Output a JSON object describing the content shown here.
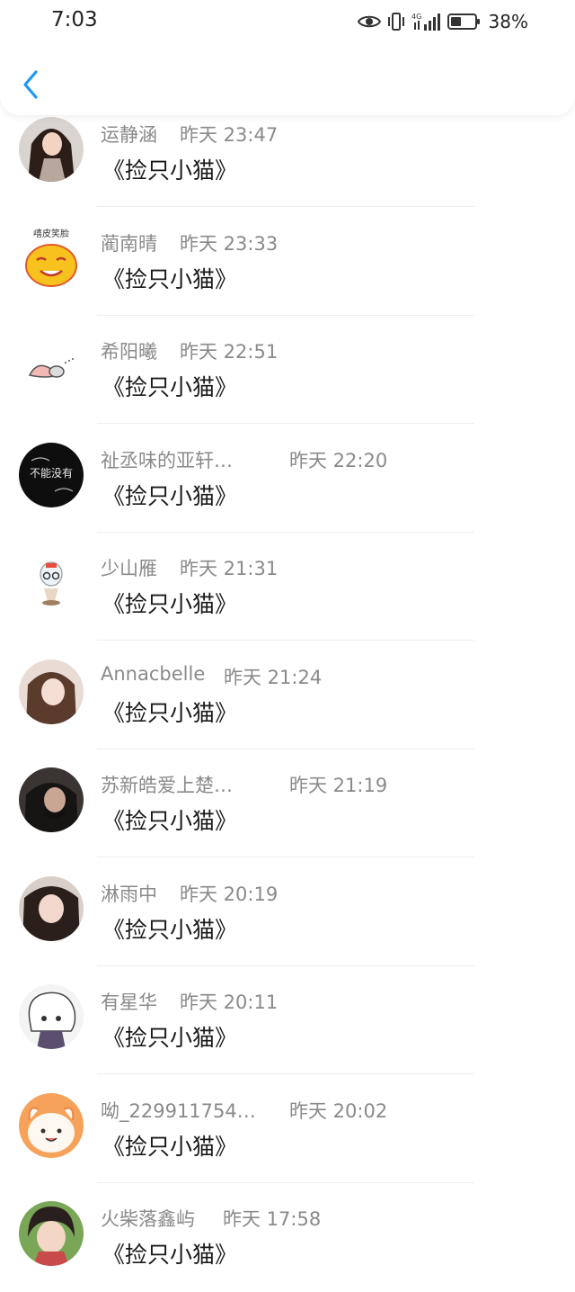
{
  "status_bar": {
    "time": "7:03",
    "network": "4G",
    "battery": "38%"
  },
  "header": {
    "back_icon": "chevron-left-icon",
    "accent_color": "#2196f3"
  },
  "items": [
    {
      "name": "运静涵",
      "time": "昨天 23:47",
      "content": "《捡只小猫》"
    },
    {
      "name": "蔺南晴",
      "time": "昨天 23:33",
      "content": "《捡只小猫》"
    },
    {
      "name": "希阳曦",
      "time": "昨天 22:51",
      "content": "《捡只小猫》"
    },
    {
      "name": "祉丞味的亚轩…",
      "time": "昨天 22:20",
      "content": "《捡只小猫》"
    },
    {
      "name": "少山雁",
      "time": "昨天 21:31",
      "content": "《捡只小猫》"
    },
    {
      "name": "Annacbelle",
      "time": "昨天 21:24",
      "content": "《捡只小猫》"
    },
    {
      "name": "苏新皓爱上楚…",
      "time": "昨天 21:19",
      "content": "《捡只小猫》"
    },
    {
      "name": "淋雨中",
      "time": "昨天 20:19",
      "content": "《捡只小猫》"
    },
    {
      "name": "有星华",
      "time": "昨天 20:11",
      "content": "《捡只小猫》"
    },
    {
      "name": "呦_229911754…",
      "time": "昨天 20:02",
      "content": "《捡只小猫》"
    },
    {
      "name": "火柴落鑫屿",
      "time": "昨天 17:58",
      "content": "《捡只小猫》"
    }
  ],
  "avatar_badges": {
    "smiley": "嘻皮笑脸",
    "dark_text": "不能没有"
  }
}
